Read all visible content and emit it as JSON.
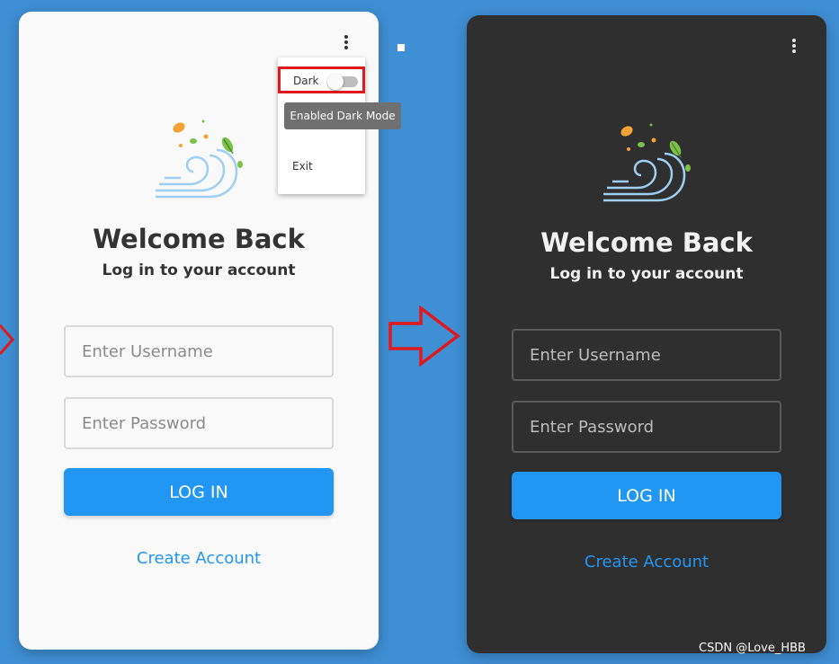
{
  "light": {
    "title": "Welcome Back",
    "subtitle": "Log in to your account",
    "username_placeholder": "Enter Username",
    "password_placeholder": "Enter Password",
    "login_label": "LOG IN",
    "create_label": "Create Account",
    "menu": {
      "dark_label": "Dark",
      "dark_enabled": false,
      "exit_label": "Exit",
      "tooltip": "Enabled Dark Mode"
    }
  },
  "dark": {
    "title": "Welcome Back",
    "subtitle": "Log in to your account",
    "username_placeholder": "Enter Username",
    "password_placeholder": "Enter Password",
    "login_label": "LOG IN",
    "create_label": "Create Account"
  },
  "watermark": "CSDN @Love_HBB",
  "colors": {
    "background": "#3f8fd4",
    "accent": "#2196f3",
    "highlight": "#e0191f",
    "light_card": "#f9f9f9",
    "dark_card": "#2f2f2f"
  },
  "icons": {
    "menu": "kebab-menu-icon",
    "logo": "wind-leaves-logo-icon",
    "arrow": "right-arrow-icon"
  }
}
